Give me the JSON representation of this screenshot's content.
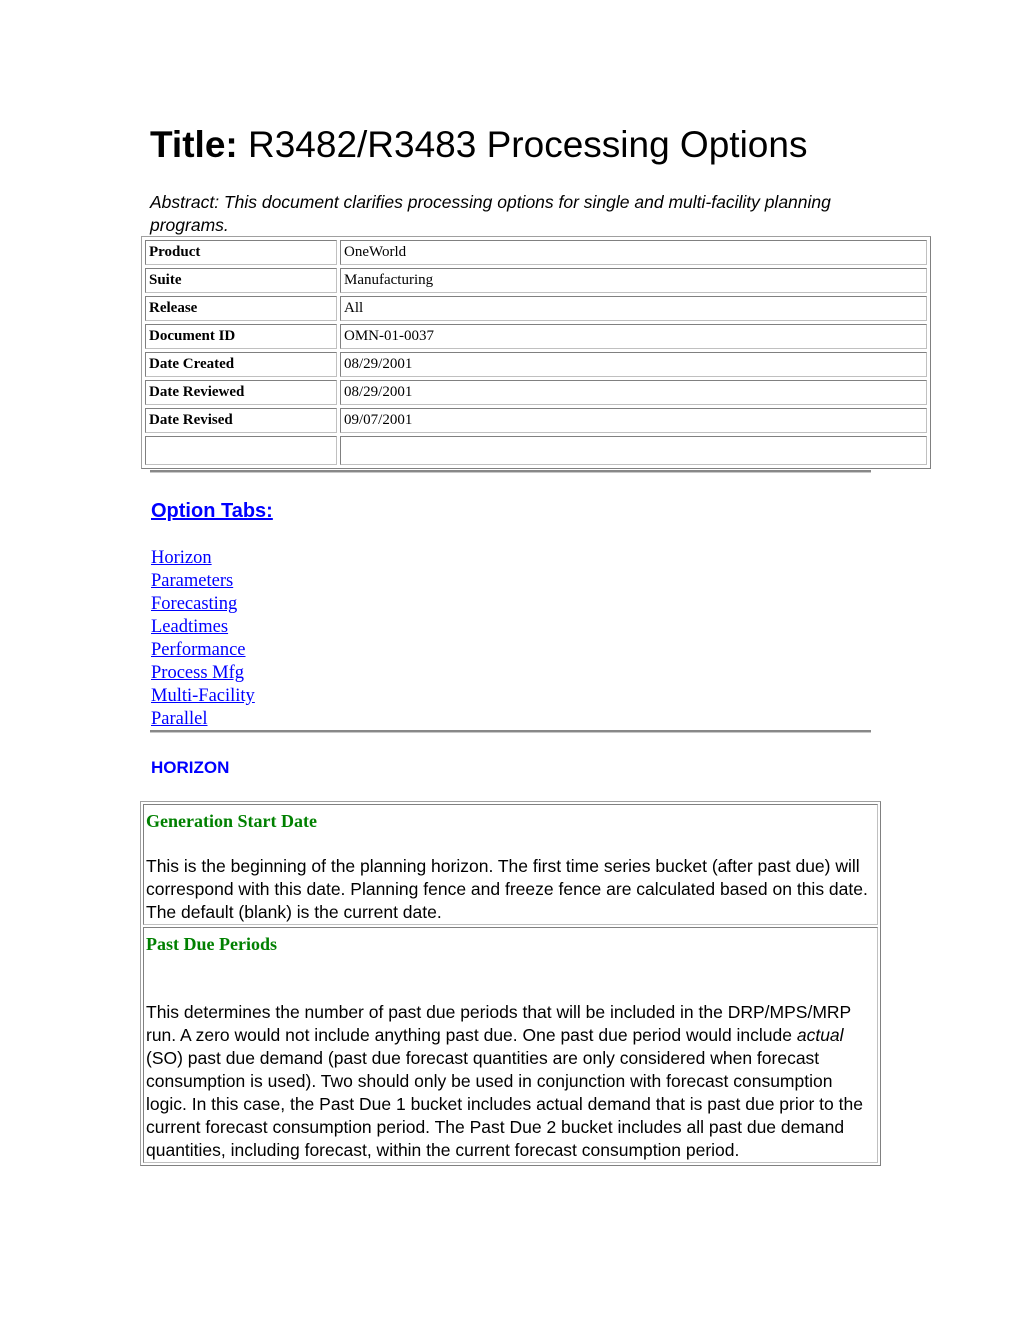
{
  "document": {
    "title_label": "Title:",
    "title_text": " R3482/R3483 Processing Options",
    "abstract": "Abstract:  This document clarifies processing options for single and multi-facility planning programs."
  },
  "metadata": [
    {
      "key": "Product",
      "value": "OneWorld"
    },
    {
      "key": "Suite",
      "value": "Manufacturing"
    },
    {
      "key": "Release",
      "value": "All"
    },
    {
      "key": "Document ID",
      "value": "OMN-01-0037"
    },
    {
      "key": "Date Created",
      "value": "08/29/2001"
    },
    {
      "key": "Date Reviewed",
      "value": "08/29/2001"
    },
    {
      "key": "Date Revised",
      "value": "09/07/2001"
    },
    {
      "key": "",
      "value": ""
    }
  ],
  "option_tabs": {
    "heading": "Option Tabs:",
    "links": [
      "Horizon",
      "Parameters",
      "Forecasting",
      "Leadtimes",
      "Performance",
      "Process Mfg",
      "Multi-Facility",
      "Parallel"
    ]
  },
  "horizon": {
    "heading": "HORIZON",
    "options": [
      {
        "name": "Generation Start Date",
        "description": "This is the beginning of the planning horizon. The first time series bucket (after past due) will correspond with this date. Planning fence and freeze fence are calculated based on this date. The default (blank) is the current date."
      },
      {
        "name": "Past Due Periods",
        "description_before_italic": "This determines the number of past due periods that will be included in the DRP/MPS/MRP run. A zero would not include anything past due. One past due period would include ",
        "description_italic": "actual",
        "description_after_italic": " (SO) past due demand (past due forecast quantities are only considered when forecast consumption is used). Two should only be used in conjunction with forecast consumption logic. In this case, the Past Due 1 bucket includes actual demand that is past due prior to the current forecast consumption period. The Past Due 2 bucket includes all past due demand quantities, including forecast, within the current forecast consumption period."
      }
    ]
  },
  "colors": {
    "link_blue": "#0000ff",
    "option_green": "#008000",
    "rule_gray": "#888888"
  }
}
